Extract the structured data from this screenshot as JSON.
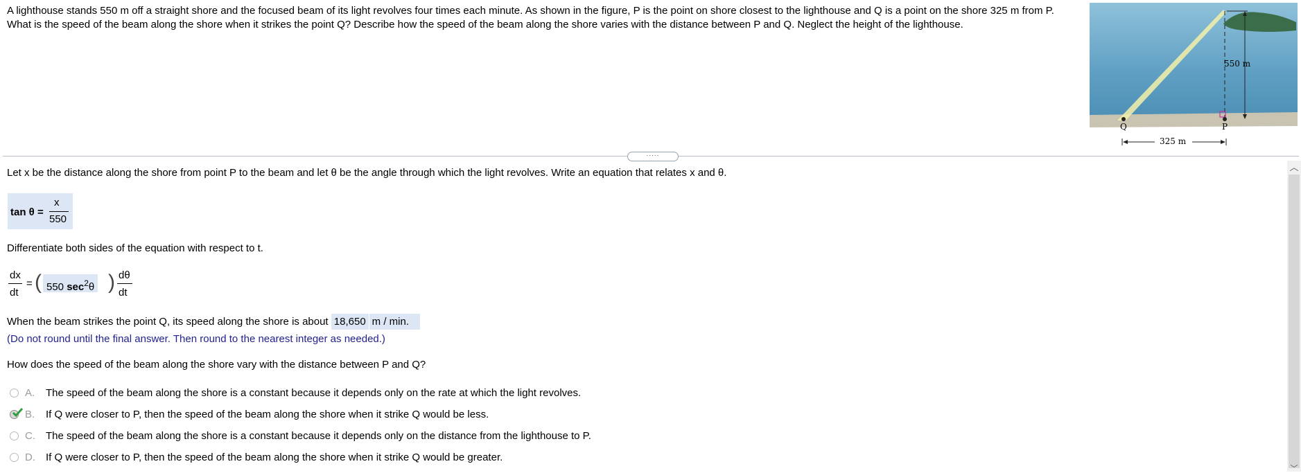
{
  "problem": {
    "text": "A lighthouse stands 550 m off a straight shore and the focused beam of its light revolves four times each minute. As shown in the figure, P is the point on shore closest to the lighthouse and Q is a point on the shore 325 m from P. What is the speed of the beam along the shore when it strikes the point Q? Describe how the speed of the beam along the shore varies with the distance between P and Q. Neglect the height of the lighthouse."
  },
  "figure": {
    "label_distance_vertical": "550 m",
    "label_distance_horizontal": "325 m",
    "label_q": "Q",
    "label_p": "P"
  },
  "collapse_handle": ".....",
  "step1": {
    "prompt": "Let x be the distance along the shore from point P to the beam and let θ be the angle through which the light revolves. Write an equation that relates x and θ.",
    "lhs": "tan θ =",
    "numerator": "x",
    "denominator": "550"
  },
  "step2": {
    "prompt": "Differentiate both sides of the equation with respect to t.",
    "lhs_num": "dx",
    "lhs_den": "dt",
    "equals": "=",
    "answer_coef": "550",
    "answer_func": "sec",
    "answer_exp": "2",
    "answer_var": "θ",
    "rhs_num": "dθ",
    "rhs_den": "dt"
  },
  "step3": {
    "prompt": "When the beam strikes the point Q, its speed along the shore is about",
    "answer_value": "18,650",
    "answer_unit": "m / min.",
    "hint": "(Do not round until the final answer. Then round to the nearest integer as needed.)"
  },
  "step4": {
    "prompt": "How does the speed of the beam along the shore vary with the distance between P and Q?",
    "choices": [
      {
        "letter": "A.",
        "text": "The speed of the beam along the shore is a constant because it depends only on the rate at which the light revolves.",
        "selected": false
      },
      {
        "letter": "B.",
        "text": "If Q were closer to P, then the speed of the beam along the shore when it strike Q would be less.",
        "selected": true
      },
      {
        "letter": "C.",
        "text": "The speed of the beam along the shore is a constant because it depends only on the distance from the lighthouse to P.",
        "selected": false
      },
      {
        "letter": "D.",
        "text": "If Q were closer to P, then the speed of the beam along the shore when it strike Q would be greater.",
        "selected": false
      }
    ]
  },
  "colors": {
    "answer_highlight": "#dce6f5",
    "hint_text": "#1f1f8f",
    "check_mark": "#2e9e3e",
    "sea": "#6aa9c9",
    "sand": "#c9c4b2",
    "beam": "#f3f0a8",
    "right_angle_marker": "#c0379a"
  }
}
